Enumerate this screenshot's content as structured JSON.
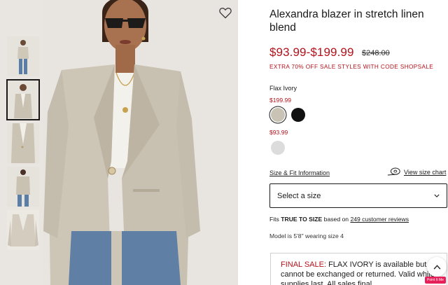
{
  "product": {
    "title": "Alexandra blazer in stretch linen blend",
    "price_range": "$93.99-$199.99",
    "original_price": "$248.00",
    "promo": "EXTRA 70% OFF SALE STYLES WITH CODE SHOPSALE"
  },
  "colors": {
    "selected_name": "Flax Ivory",
    "group1_price": "$199.99",
    "group2_price": "$93.99",
    "swatches": [
      {
        "name": "flax-ivory",
        "hex": "#c9c3b6"
      },
      {
        "name": "black",
        "hex": "#111111"
      },
      {
        "name": "light-grey",
        "hex": "#dcdcdc"
      }
    ]
  },
  "size": {
    "info_link": "Size & Fit Information",
    "chart_link": "View size chart",
    "select_placeholder": "Select a size"
  },
  "fit": {
    "prefix": "Fits ",
    "emphasis": "TRUE TO SIZE",
    "middle": " based on ",
    "reviews_link": "249 customer reviews"
  },
  "model_note": "Model is 5'8\" wearing size 4",
  "final_sale": {
    "label": "FINAL SALE:",
    "text": " FLAX IVORY is available but cannot be exchanged or returned. Valid while supplies last. All sales final."
  },
  "badge": "Point It Me",
  "icons": {
    "wishlist": "heart-outline-icon",
    "size_chart": "measuring-tape-icon",
    "select_caret": "chevron-down-icon",
    "scroll_top": "chevron-up-icon"
  },
  "accent_color": "#b5121b"
}
